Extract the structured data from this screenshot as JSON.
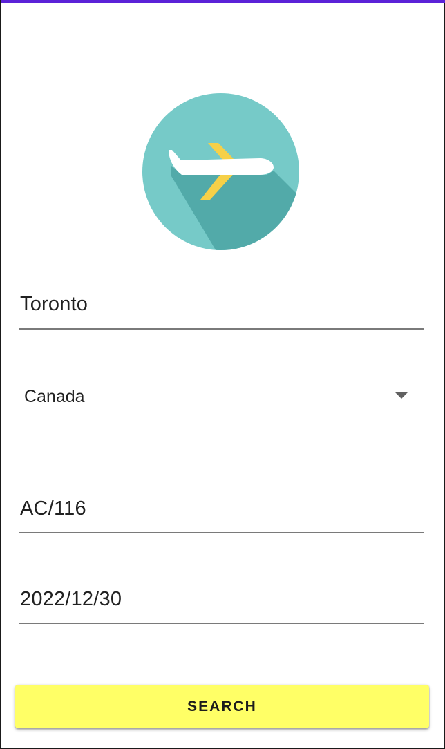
{
  "form": {
    "city_value": "Toronto",
    "country_selected": "Canada",
    "flight_value": "AC/116",
    "date_value": "2022/12/30"
  },
  "search_button": {
    "label": "SEARCH"
  },
  "icons": {
    "logo": "airplane-icon",
    "dropdown": "dropdown-arrow-icon"
  },
  "colors": {
    "status_accent": "#5b22d8",
    "logo_circle": "#76cac8",
    "logo_shadow": "#52aaa9",
    "plane_body": "#ffffff",
    "plane_wing": "#f6d048",
    "button_background": "#ffff66"
  }
}
